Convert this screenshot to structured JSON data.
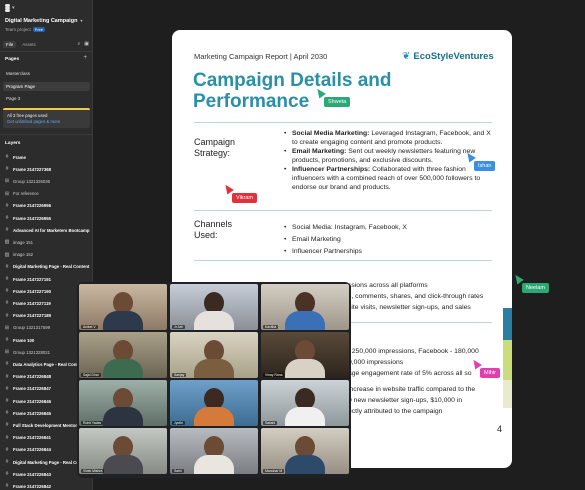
{
  "project": {
    "name": "Digital Marketing Campaign",
    "team": "Team project",
    "badge": "Free"
  },
  "tabs": {
    "file": "File",
    "assets": "Assets"
  },
  "pages_section": {
    "title": "Pages",
    "items": [
      "Masterclass",
      "Program Page",
      "Page 3"
    ],
    "notice_line1": "All 3 free pages used",
    "notice_line2": "Get unlimited pages & more"
  },
  "layers_section": {
    "title": "Layers",
    "items": [
      {
        "icon": "#",
        "label": "Frame",
        "bold": true
      },
      {
        "icon": "#",
        "label": "Frame 2147227368",
        "bold": true
      },
      {
        "icon": "⊞",
        "label": "Group 1321326036",
        "bold": false
      },
      {
        "icon": "⊞",
        "label": "For reference",
        "bold": false
      },
      {
        "icon": "#",
        "label": "Frame 2147226956",
        "bold": true
      },
      {
        "icon": "#",
        "label": "Frame 2147226955",
        "bold": true
      },
      {
        "icon": "#",
        "label": "Advanced AI for Marketers Bootcamp",
        "bold": true
      },
      {
        "icon": "▨",
        "label": "image 151",
        "bold": false
      },
      {
        "icon": "▨",
        "label": "image 152",
        "bold": false
      },
      {
        "icon": "#",
        "label": "Digital Marketing Page - Real Content",
        "bold": true
      },
      {
        "icon": "#",
        "label": "Frame 2147227191",
        "bold": true
      },
      {
        "icon": "#",
        "label": "Frame 2147227190",
        "bold": true
      },
      {
        "icon": "#",
        "label": "Frame 2147227119",
        "bold": true
      },
      {
        "icon": "#",
        "label": "Frame 2147227189",
        "bold": true
      },
      {
        "icon": "⊞",
        "label": "Group 1321317599",
        "bold": false
      },
      {
        "icon": "#",
        "label": "Frame 100",
        "bold": true
      },
      {
        "icon": "⊞",
        "label": "Group 1321328021",
        "bold": false
      },
      {
        "icon": "#",
        "label": "Data Analytics Page - Real Content",
        "bold": true
      },
      {
        "icon": "#",
        "label": "Frame 2147226848",
        "bold": true
      },
      {
        "icon": "#",
        "label": "Frame 2147226847",
        "bold": true
      },
      {
        "icon": "#",
        "label": "Frame 2147226846",
        "bold": true
      },
      {
        "icon": "#",
        "label": "Frame 2147226845",
        "bold": true
      },
      {
        "icon": "#",
        "label": "Full Stack Development Mentorship",
        "bold": true
      },
      {
        "icon": "#",
        "label": "Frame 2147226841",
        "bold": true
      },
      {
        "icon": "#",
        "label": "Frame 2147226844",
        "bold": true
      },
      {
        "icon": "#",
        "label": "Digital Marketing Page - Real Content",
        "bold": true
      },
      {
        "icon": "#",
        "label": "Frame 2147226843",
        "bold": true
      },
      {
        "icon": "#",
        "label": "Frame 2147226842",
        "bold": true
      }
    ]
  },
  "document": {
    "header": "Marketing Campaign Report | April 2030",
    "logo": "EcoStyleVentures",
    "title": "Campaign Details and Performance",
    "strategy_label": "Campaign Strategy:",
    "strategy": [
      {
        "bold": "Social Media Marketing:",
        "text": " Leveraged Instagram, Facebook, and X to create engaging content and promote products."
      },
      {
        "bold": "Email Marketing:",
        "text": " Sent out weekly newsletters featuring new products, promotions, and exclusive discounts."
      },
      {
        "bold": "Influencer Partnerships:",
        "text": " Collaborated with three fashion influencers with a combined reach of over 500,000 followers to endorse our brand and products."
      }
    ],
    "channels_label": "Channels Used:",
    "channels": [
      "Social Media: Instagram, Facebook, X",
      "Email Marketing",
      "Influencer Partnerships"
    ],
    "fragments": [
      "ssions across all platforms",
      "s, comments, shares, and click-through rates",
      "site visits, newsletter sign-ups, and sales",
      ", 250,000 impressions, Facebook - 180,000",
      "0,000 impressions",
      "age engagement rate of 5% across all so",
      "increase in website traffic compared to the",
      "0 new newsletter sign-ups, $10,000 in",
      "ectly attributed to the campaign"
    ],
    "page_number": "4"
  },
  "cursors": [
    {
      "name": "Shweta",
      "color": "#2aa876"
    },
    {
      "name": "Ishan",
      "color": "#3b8fe0"
    },
    {
      "name": "Vikram",
      "color": "#e0323c"
    },
    {
      "name": "Neelam",
      "color": "#2aa876"
    },
    {
      "name": "Mihir",
      "color": "#e23fae"
    }
  ],
  "participants": [
    "Aniket V",
    "Jr Arti",
    "Kavitha",
    "Sajid Dhar",
    "Sanjay",
    "Vinay Rana",
    "Rohit Yadav",
    "Jyothi",
    "Sakshi",
    "Vivek Mishra",
    "Sahil",
    "Manohar M"
  ]
}
